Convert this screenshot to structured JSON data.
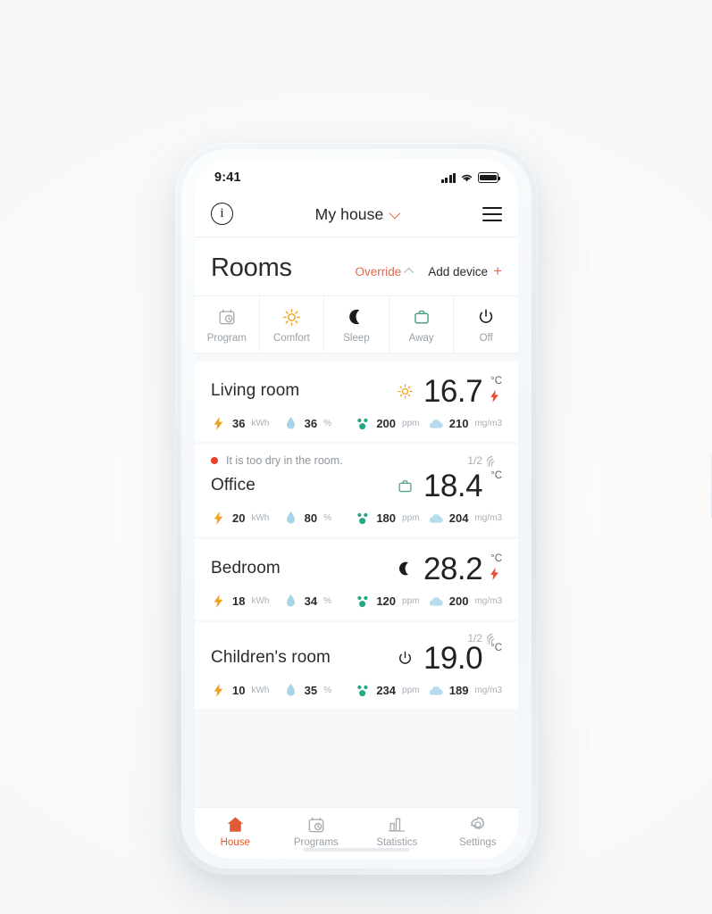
{
  "theme": {
    "accent": "#e8714a",
    "accent_dark": "#de6b4b",
    "alert_red": "#e8402b",
    "bolt_orange": "#f0a322",
    "bolt_red": "#e8503a",
    "water_blue": "#a8d4e8",
    "co2_green": "#27a884",
    "cloud_blue": "#b6dced",
    "away_green": "#4a9e7f",
    "sun_orange": "#f0a322",
    "text_dark": "#2b2b2b",
    "text_muted": "#9aa1a8",
    "screen_bg": "#f7f8f9"
  },
  "status_bar": {
    "time": "9:41",
    "signal_icon": "cellular-bars-icon",
    "wifi_icon": "wifi-icon",
    "battery_icon": "battery-full-icon"
  },
  "header": {
    "info_icon": "info-icon",
    "info_glyph": "i",
    "title": "My house",
    "chevron_icon": "chevron-down-icon",
    "menu_icon": "hamburger-menu-icon"
  },
  "rooms_section": {
    "title": "Rooms",
    "override_label": "Override",
    "override_chevron_icon": "chevron-up-icon",
    "add_device_label": "Add device",
    "add_device_plus": "+"
  },
  "modes": [
    {
      "label": "Program",
      "icon": "calendar-clock-icon",
      "active": false
    },
    {
      "label": "Comfort",
      "icon": "sun-icon",
      "active": false
    },
    {
      "label": "Sleep",
      "icon": "moon-icon",
      "active": false
    },
    {
      "label": "Away",
      "icon": "briefcase-icon",
      "active": false
    },
    {
      "label": "Off",
      "icon": "power-icon",
      "active": false
    }
  ],
  "rooms": [
    {
      "name": "Living room",
      "mode_icon": "sun-icon",
      "temperature": "16.7",
      "degree_unit": "°C",
      "heating_icon": "lightning-bolt-icon",
      "heating": true,
      "alert": null,
      "signal": null,
      "metrics": [
        {
          "icon": "lightning-bolt-icon",
          "value": "36",
          "unit": "kWh"
        },
        {
          "icon": "water-drop-icon",
          "value": "36",
          "unit": "%"
        },
        {
          "icon": "co2-molecule-icon",
          "value": "200",
          "unit": "ppm"
        },
        {
          "icon": "cloud-icon",
          "value": "210",
          "unit": "mg/m3"
        }
      ]
    },
    {
      "name": "Office",
      "mode_icon": "briefcase-icon",
      "temperature": "18.4",
      "degree_unit": "°C",
      "heating_icon": null,
      "heating": false,
      "alert": "It is too dry in the room.",
      "signal": {
        "fraction": "1/2",
        "icon": "signal-arc-icon"
      },
      "metrics": [
        {
          "icon": "lightning-bolt-icon",
          "value": "20",
          "unit": "kWh"
        },
        {
          "icon": "water-drop-icon",
          "value": "80",
          "unit": "%"
        },
        {
          "icon": "co2-molecule-icon",
          "value": "180",
          "unit": "ppm"
        },
        {
          "icon": "cloud-icon",
          "value": "204",
          "unit": "mg/m3"
        }
      ]
    },
    {
      "name": "Bedroom",
      "mode_icon": "moon-icon",
      "temperature": "28.2",
      "degree_unit": "°C",
      "heating_icon": "lightning-bolt-icon",
      "heating": true,
      "alert": null,
      "signal": null,
      "metrics": [
        {
          "icon": "lightning-bolt-icon",
          "value": "18",
          "unit": "kWh"
        },
        {
          "icon": "water-drop-icon",
          "value": "34",
          "unit": "%"
        },
        {
          "icon": "co2-molecule-icon",
          "value": "120",
          "unit": "ppm"
        },
        {
          "icon": "cloud-icon",
          "value": "200",
          "unit": "mg/m3"
        }
      ]
    },
    {
      "name": "Children's room",
      "mode_icon": "power-icon",
      "temperature": "19.0",
      "degree_unit": "°C",
      "heating_icon": null,
      "heating": false,
      "alert": null,
      "signal": {
        "fraction": "1/2",
        "icon": "signal-arc-icon"
      },
      "metrics": [
        {
          "icon": "lightning-bolt-icon",
          "value": "10",
          "unit": "kWh"
        },
        {
          "icon": "water-drop-icon",
          "value": "35",
          "unit": "%"
        },
        {
          "icon": "co2-molecule-icon",
          "value": "234",
          "unit": "ppm"
        },
        {
          "icon": "cloud-icon",
          "value": "189",
          "unit": "mg/m3"
        }
      ]
    }
  ],
  "tabs": [
    {
      "label": "House",
      "icon": "home-icon",
      "active": true
    },
    {
      "label": "Programs",
      "icon": "calendar-clock-icon",
      "active": false
    },
    {
      "label": "Statistics",
      "icon": "bar-chart-icon",
      "active": false
    },
    {
      "label": "Settings",
      "icon": "gear-icon",
      "active": false
    }
  ]
}
